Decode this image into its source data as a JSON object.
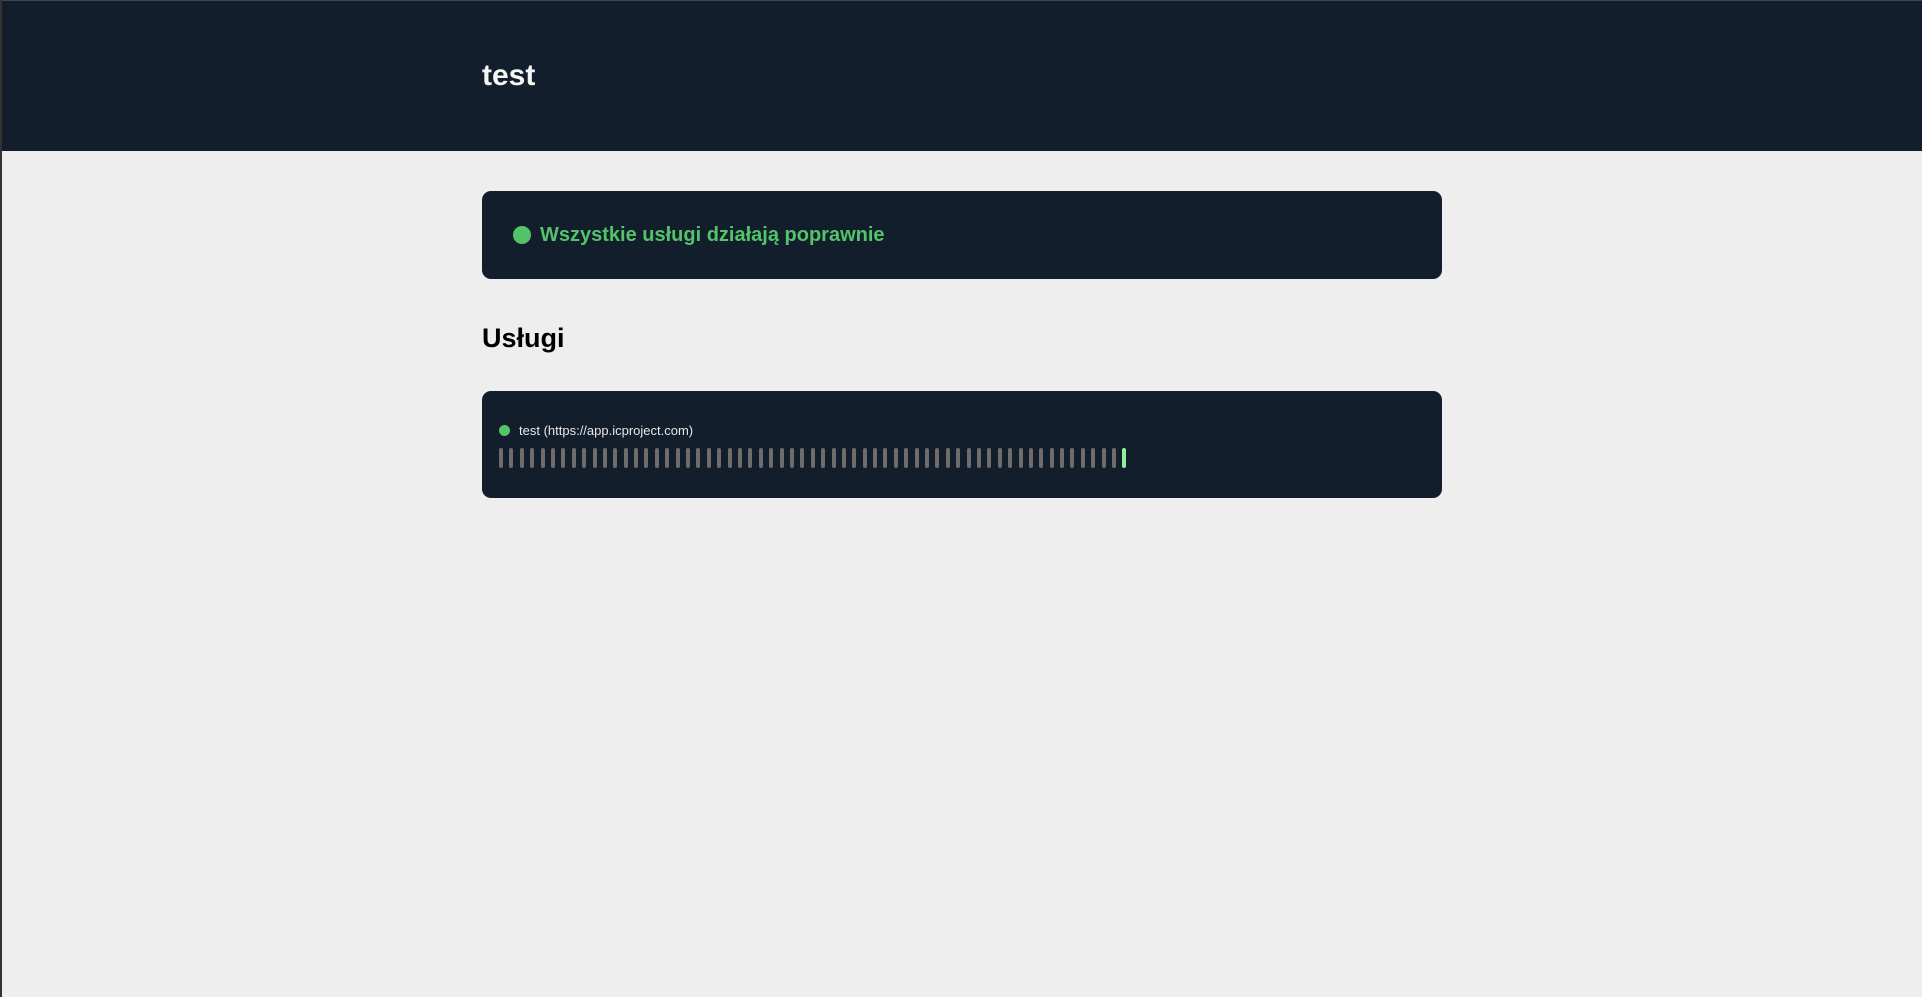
{
  "header": {
    "title": "test"
  },
  "overall_status": {
    "text": "Wszystkie usługi działają poprawnie",
    "color": "#53c36a"
  },
  "services_heading": "Usługi",
  "services": [
    {
      "name": "test (https://app.icproject.com)",
      "status": "up",
      "history": [
        "none",
        "none",
        "none",
        "none",
        "none",
        "none",
        "none",
        "none",
        "none",
        "none",
        "none",
        "none",
        "none",
        "none",
        "none",
        "none",
        "none",
        "none",
        "none",
        "none",
        "none",
        "none",
        "none",
        "none",
        "none",
        "none",
        "none",
        "none",
        "none",
        "none",
        "none",
        "none",
        "none",
        "none",
        "none",
        "none",
        "none",
        "none",
        "none",
        "none",
        "none",
        "none",
        "none",
        "none",
        "none",
        "none",
        "none",
        "none",
        "none",
        "none",
        "none",
        "none",
        "none",
        "none",
        "none",
        "none",
        "none",
        "none",
        "none",
        "none",
        "up"
      ]
    }
  ]
}
